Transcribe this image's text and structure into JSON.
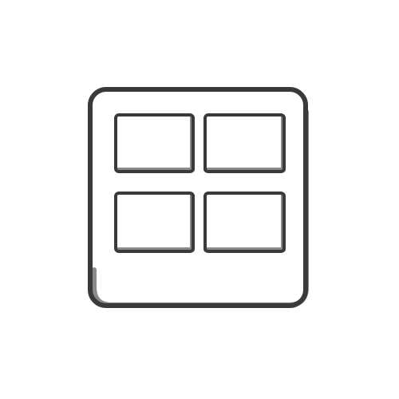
{
  "icon": {
    "name": "grid-view-icon",
    "stroke_color": "#3a3a3a",
    "shadow_color": "#8a8a8a",
    "background_color": "#ffffff"
  }
}
